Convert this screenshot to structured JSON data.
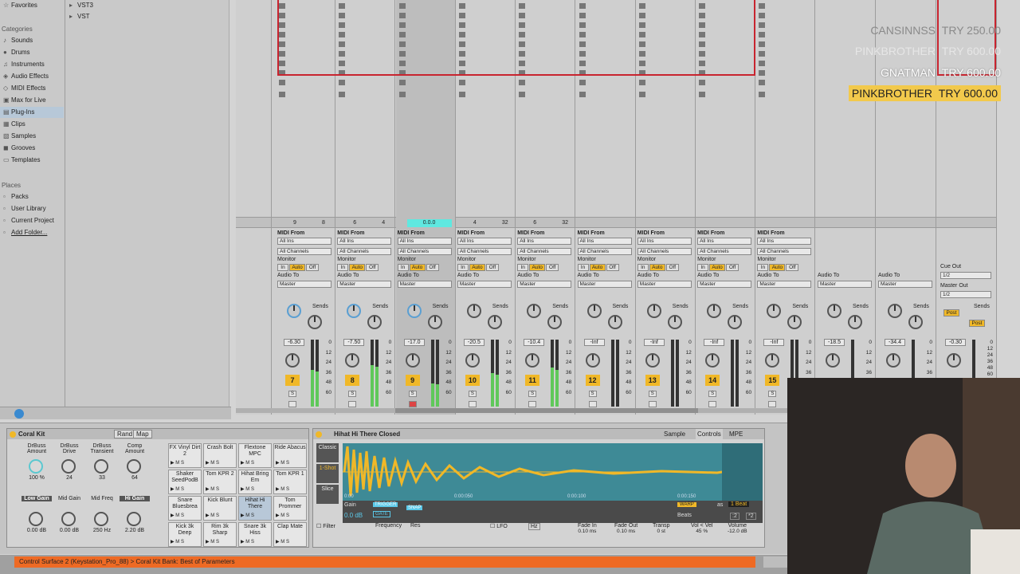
{
  "browser": {
    "favorites": "Favorites",
    "vst3": "VST3",
    "vst": "VST",
    "categories_header": "Categories",
    "categories": [
      "Sounds",
      "Drums",
      "Instruments",
      "Audio Effects",
      "MIDI Effects",
      "Max for Live",
      "Plug-Ins",
      "Clips",
      "Samples",
      "Grooves",
      "Templates"
    ],
    "selected_category": "Plug-Ins",
    "places_header": "Places",
    "places": [
      "Packs",
      "User Library",
      "Current Project",
      "Add Folder..."
    ]
  },
  "overlay": {
    "rows": [
      {
        "name": "CANSINNSS",
        "amount": "TRY 250.00"
      },
      {
        "name": "PINKBROTHER",
        "amount": "TRY 600.00"
      },
      {
        "name": "GNATMAN",
        "amount": "TRY 600.00"
      },
      {
        "name": "PINKBROTHER",
        "amount": "TRY 600.00"
      }
    ]
  },
  "tracks": [
    {
      "num": "7",
      "vol": "-6.30",
      "io": "MIDI From",
      "input": "All Ins",
      "channel": "All Channels",
      "out_label": "Audio To",
      "out": "Master",
      "status_a": "9",
      "status_b": "8"
    },
    {
      "num": "8",
      "vol": "-7.50",
      "io": "MIDI From",
      "input": "All Ins",
      "channel": "All Channels",
      "out_label": "Audio To",
      "out": "Master",
      "status_a": "6",
      "status_b": "4"
    },
    {
      "num": "9",
      "vol": "-17.0",
      "io": "MIDI From",
      "input": "All Ins",
      "channel": "All Channels",
      "out_label": "Audio To",
      "out": "Master",
      "status_a": "0.0.0",
      "status_b": ""
    },
    {
      "num": "10",
      "vol": "-20.5",
      "io": "MIDI From",
      "input": "All Ins",
      "channel": "All Channels",
      "out_label": "Audio To",
      "out": "Master",
      "status_a": "4",
      "status_b": "32"
    },
    {
      "num": "11",
      "vol": "-10.4",
      "io": "MIDI From",
      "input": "All Ins",
      "channel": "All Channels",
      "out_label": "Audio To",
      "out": "Master",
      "status_a": "6",
      "status_b": "32"
    },
    {
      "num": "12",
      "vol": "-Inf",
      "io": "MIDI From",
      "input": "All Ins",
      "channel": "All Channels",
      "out_label": "Audio To",
      "out": "Master",
      "status_a": "",
      "status_b": ""
    },
    {
      "num": "13",
      "vol": "-Inf",
      "io": "MIDI From",
      "input": "All Ins",
      "channel": "All Channels",
      "out_label": "Audio To",
      "out": "Master",
      "status_a": "",
      "status_b": ""
    },
    {
      "num": "14",
      "vol": "-Inf",
      "io": "MIDI From",
      "input": "All Ins",
      "channel": "All Channels",
      "out_label": "Audio To",
      "out": "Master",
      "status_a": "",
      "status_b": ""
    },
    {
      "num": "15",
      "vol": "-Inf",
      "io": "MIDI From",
      "input": "All Ins",
      "channel": "All Channels",
      "out_label": "Audio To",
      "out": "Master",
      "status_a": "",
      "status_b": ""
    }
  ],
  "returns": [
    {
      "vol": "-18.5",
      "out_label": "Audio To",
      "out": "Master"
    },
    {
      "vol": "-34.4",
      "out_label": "Audio To",
      "out": "Master"
    }
  ],
  "master": {
    "vol": "-0.30",
    "cue_label": "Cue Out",
    "cue": "1/2",
    "out_label": "Master Out",
    "out": "1/2",
    "post": "Post"
  },
  "mixer_labels": {
    "monitor": "Monitor",
    "in": "In",
    "auto": "Auto",
    "off": "Off",
    "sends": "Sends",
    "s": "S",
    "scale": [
      "0",
      "12",
      "24",
      "36",
      "48",
      "60"
    ]
  },
  "drum_rack": {
    "title": "Coral Kit",
    "rand": "Rand",
    "map": "Map",
    "macros_top": [
      {
        "label": "DrBuss Amount",
        "value": "100 %"
      },
      {
        "label": "DrBuss Drive",
        "value": "24"
      },
      {
        "label": "DrBuss Transient",
        "value": "33"
      },
      {
        "label": "Comp Amount",
        "value": "64"
      }
    ],
    "macros_bottom": [
      {
        "label": "Low Gain",
        "value": "0.00 dB"
      },
      {
        "label": "Mid Gain",
        "value": "0.00 dB"
      },
      {
        "label": "Mid Freq",
        "value": "250 Hz"
      },
      {
        "label": "Hi Gain",
        "value": "2.20 dB"
      }
    ],
    "pads": [
      "FX Vinyl Dirt 2",
      "Crash Bolt",
      "Flextone MPC",
      "Ride Abacus",
      "Shaker SeedPodB",
      "Tom KPR 2",
      "Hihat Bring Em",
      "Tom KPR 1",
      "Snare Bluesbrea",
      "Kick Blunt",
      "Hihat Hi There",
      "Tom Prommer",
      "Kick 3k Deep",
      "Rim 3k Sharp",
      "Snare 3k Hiss",
      "Clap Mate"
    ],
    "selected_pad": "Hihat Hi There"
  },
  "sampler": {
    "title": "Hihat Hi There Closed",
    "tabs": [
      "Sample",
      "Controls",
      "MPE"
    ],
    "modes": [
      "Classic",
      "1-Shot",
      "Slice"
    ],
    "gain_label": "Gain",
    "gain": "0.0 dB",
    "trigger": "TRIGGER",
    "gate": "GATE",
    "snap": "SNAP",
    "times": [
      "0:00",
      "0:00:050",
      "0:00:100",
      "0:00:150"
    ],
    "warp": "WARP",
    "as": "as",
    "beat": "1 Beat",
    "beats": "Beats",
    "div": ":2",
    "mul": "*2",
    "filter": "Filter",
    "frequency": "Frequency",
    "res": "Res",
    "lfo": "LFO",
    "hz": "Hz",
    "fade_in_label": "Fade In",
    "fade_in": "0.10 ms",
    "fade_out_label": "Fade Out",
    "fade_out": "0.10 ms",
    "transp_label": "Transp",
    "transp": "0 st",
    "vol_vel_label": "Vol < Vel",
    "vol_vel": "45 %",
    "volume_label": "Volume",
    "volume": "-12.0 dB"
  },
  "status": {
    "message": "Control Surface 2 (Keystation_Pro_88) > Coral Kit Bank: Best of Parameters"
  }
}
